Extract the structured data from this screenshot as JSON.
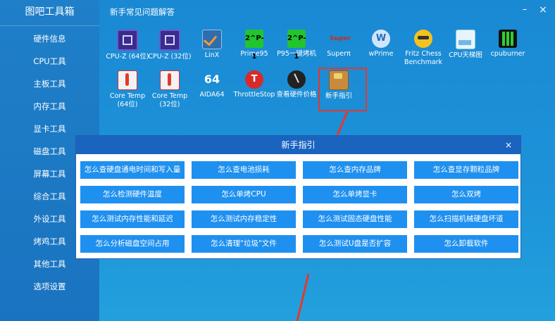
{
  "app": {
    "title": "图吧工具箱"
  },
  "sidebar": {
    "items": [
      {
        "label": "硬件信息"
      },
      {
        "label": "CPU工具"
      },
      {
        "label": "主板工具"
      },
      {
        "label": "内存工具"
      },
      {
        "label": "显卡工具"
      },
      {
        "label": "磁盘工具"
      },
      {
        "label": "屏幕工具"
      },
      {
        "label": "综合工具"
      },
      {
        "label": "外设工具"
      },
      {
        "label": "烤鸡工具"
      },
      {
        "label": "其他工具"
      },
      {
        "label": "选项设置"
      }
    ]
  },
  "main": {
    "title": "新手常见问题解答",
    "window_buttons": {
      "minimize": "–",
      "close": "×"
    },
    "tools": [
      {
        "label": "CPU-Z (64位)",
        "icon": "cpuz-icon"
      },
      {
        "label": "CPU-Z (32位)",
        "icon": "cpuz-icon"
      },
      {
        "label": "LinX",
        "icon": "linx-icon"
      },
      {
        "label": "Prime95",
        "icon": "prime95-icon"
      },
      {
        "label": "P95一键烤机",
        "icon": "prime95-icon"
      },
      {
        "label": "Superπ",
        "icon": "superpi-icon"
      },
      {
        "label": "wPrime",
        "icon": "wprime-icon"
      },
      {
        "label": "Fritz Chess Benchmark",
        "icon": "fritz-icon"
      },
      {
        "label": "CPU天梯图",
        "icon": "ladder-icon"
      },
      {
        "label": "cpuburner",
        "icon": "cpuburner-icon"
      },
      {
        "label": "Core Temp (64位)",
        "icon": "coretemp-icon"
      },
      {
        "label": "Core Temp (32位)",
        "icon": "coretemp-icon"
      },
      {
        "label": "AIDA64",
        "icon": "aida64-icon"
      },
      {
        "label": "ThrottleStop",
        "icon": "throttlestop-icon"
      },
      {
        "label": "查看硬件价格",
        "icon": "price-icon"
      },
      {
        "label": "新手指引",
        "icon": "guide-icon"
      }
    ],
    "icon_text": {
      "prime": "2^P-1",
      "aida": "64",
      "superpi": "Super",
      "wprime": "W",
      "throttle": "T"
    }
  },
  "dialog": {
    "title": "新手指引",
    "close": "×",
    "questions": [
      "怎么查硬盘通电时间和写入量",
      "怎么查电池损耗",
      "怎么查内存品牌",
      "怎么查显存颗粒品牌",
      "怎么检测硬件温度",
      "怎么单烤CPU",
      "怎么单烤显卡",
      "怎么双烤",
      "怎么测试内存性能和延迟",
      "怎么测试内存稳定性",
      "怎么测试固态硬盘性能",
      "怎么扫描机械硬盘坏道",
      "怎么分析磁盘空间占用",
      "怎么清理\"垃圾\"文件",
      "怎么测试U盘是否扩容",
      "怎么卸载软件"
    ]
  },
  "colors": {
    "accent": "#1e90f0",
    "highlight": "#e03a2f",
    "dialog_header": "#1a64c0"
  }
}
